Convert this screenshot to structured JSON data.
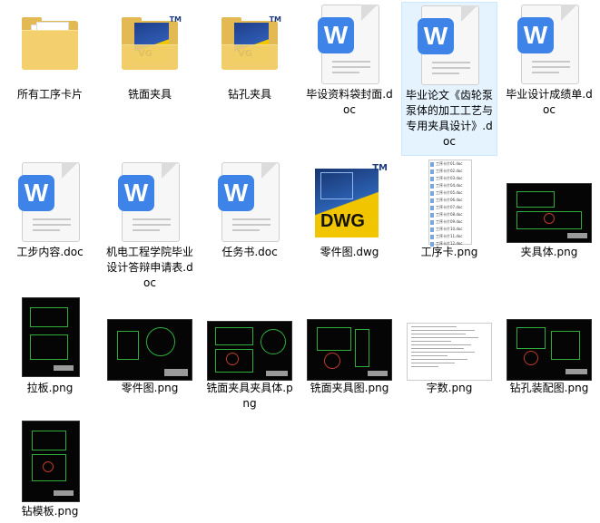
{
  "items": [
    {
      "label": "所有工序卡片",
      "type": "folder"
    },
    {
      "label": "铣面夹具",
      "type": "folder-dwg",
      "badge": "VG",
      "tm": "TM"
    },
    {
      "label": "钻孔夹具",
      "type": "folder-dwg",
      "badge": "VG",
      "tm": "TM"
    },
    {
      "label": "毕设资料袋封面.doc",
      "type": "doc",
      "glyph": "W"
    },
    {
      "label": "毕业论文《齿轮泵泵体的加工工艺与专用夹具设计》.doc",
      "type": "doc",
      "glyph": "W",
      "selected": true
    },
    {
      "label": "毕业设计成绩单.doc",
      "type": "doc",
      "glyph": "W"
    },
    {
      "label": "工步内容.doc",
      "type": "doc",
      "glyph": "W"
    },
    {
      "label": "机电工程学院毕业设计答辩申请表.doc",
      "type": "doc",
      "glyph": "W"
    },
    {
      "label": "任务书.doc",
      "type": "doc",
      "glyph": "W"
    },
    {
      "label": "零件图.dwg",
      "type": "dwg",
      "badge": "DWG",
      "tm": "TM"
    },
    {
      "label": "工序卡.png",
      "type": "list-png"
    },
    {
      "label": "夹具体.png",
      "type": "cad-wide"
    },
    {
      "label": "拉板.png",
      "type": "cad-tall"
    },
    {
      "label": "零件图.png",
      "type": "cad-wide"
    },
    {
      "label": "铣面夹具夹具体.png",
      "type": "cad-wide"
    },
    {
      "label": "铣面夹具图.png",
      "type": "cad-wide"
    },
    {
      "label": "字数.png",
      "type": "text-png"
    },
    {
      "label": "钻孔装配图.png",
      "type": "cad-wide"
    },
    {
      "label": "钻模板.png",
      "type": "cad-tall"
    }
  ],
  "list_rows": [
    "工序卡片01.doc",
    "工序卡片02.doc",
    "工序卡片03.doc",
    "工序卡片04.doc",
    "工序卡片05.doc",
    "工序卡片06.doc",
    "工序卡片07.doc",
    "工序卡片08.doc",
    "工序卡片09.doc",
    "工序卡片10.doc",
    "工序卡片11.doc",
    "工序卡片12.doc"
  ],
  "colors": {
    "selection_bg": "#e5f3ff",
    "selection_border": "#cce8ff",
    "folder": "#f3d06d",
    "word_blue": "#3d83e8",
    "cad_green": "#2fae3a"
  }
}
